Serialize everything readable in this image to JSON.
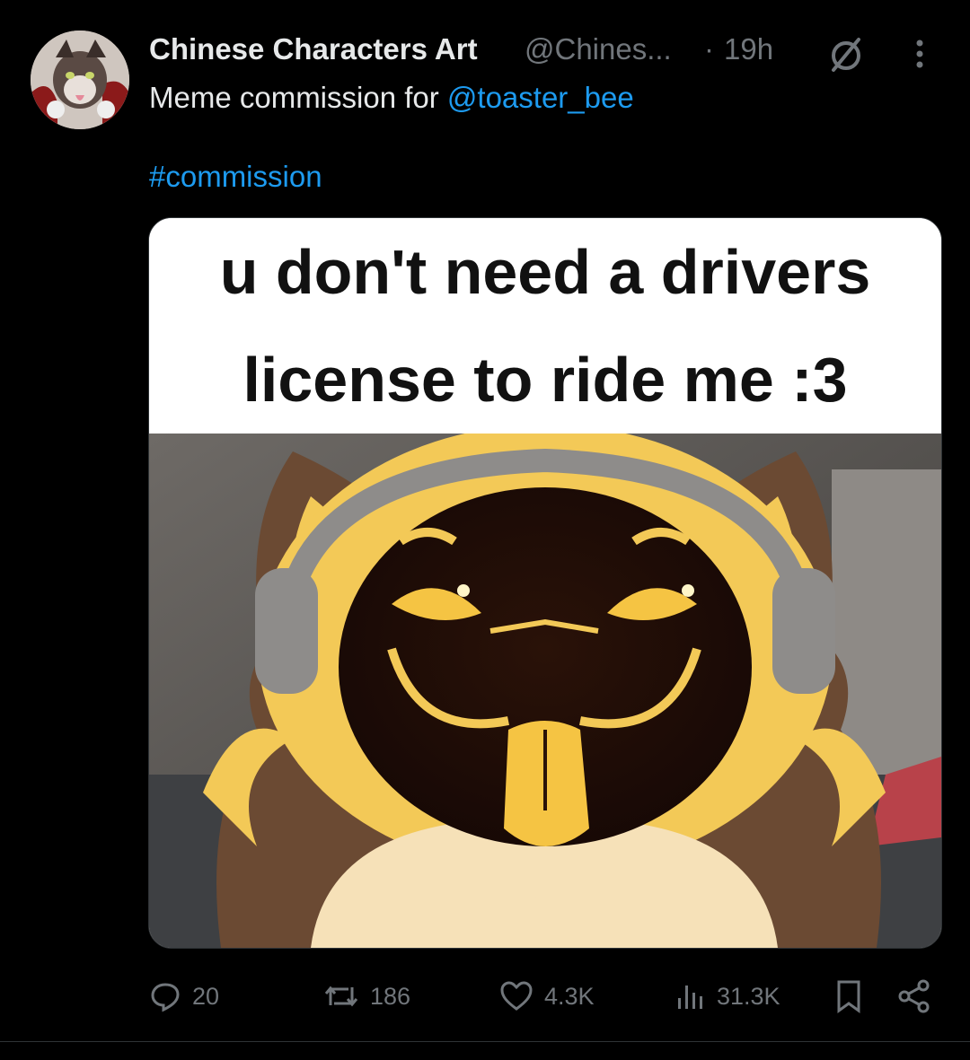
{
  "post": {
    "author_name": "Chinese Characters Art",
    "author_handle": "@Chines...",
    "separator": "·",
    "timestamp": "19h",
    "text_prefix": "Meme commission for ",
    "mention": "@toaster_bee",
    "hashtag": "#commission"
  },
  "media": {
    "caption_line1": "u don't need a drivers",
    "caption_line2": "license to ride me :3"
  },
  "actions": {
    "replies": "20",
    "reposts": "186",
    "likes": "4.3K",
    "views": "31.3K"
  },
  "colors": {
    "background": "#000000",
    "text": "#e7e9ea",
    "muted": "#71767b",
    "link": "#1d9bf0"
  },
  "icons": [
    "avatar",
    "grok-icon",
    "more-icon",
    "reply-icon",
    "repost-icon",
    "like-icon",
    "views-icon",
    "bookmark-icon",
    "share-icon"
  ]
}
